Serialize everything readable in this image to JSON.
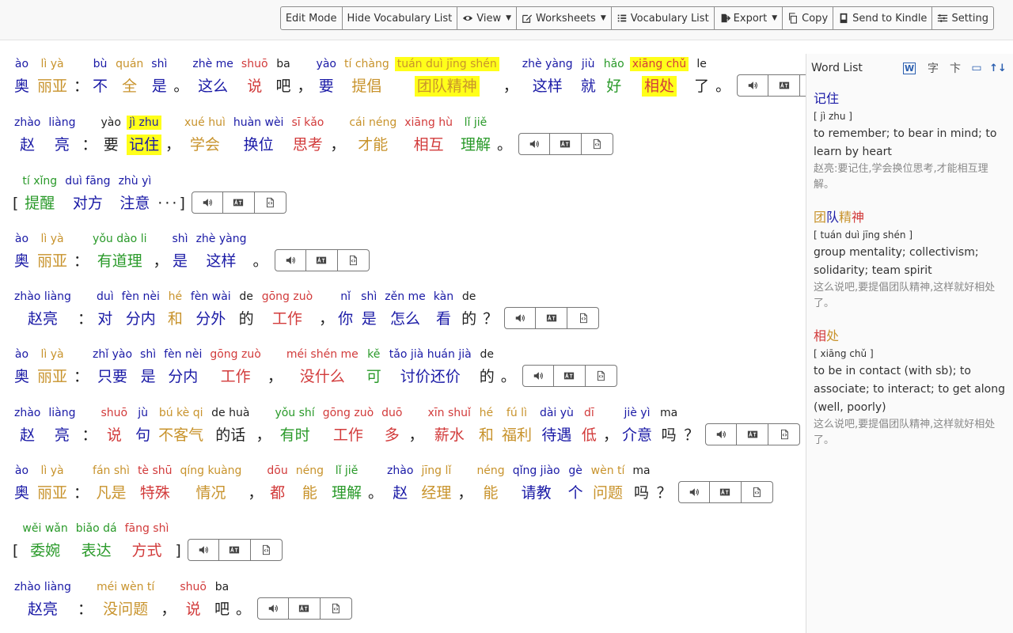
{
  "toolbar": {
    "buttons": [
      {
        "label": "Edit Mode",
        "icon": "",
        "dropdown": false
      },
      {
        "label": "Hide Vocabulary List",
        "icon": "",
        "dropdown": false
      },
      {
        "label": "View",
        "icon": "eye-icon",
        "dropdown": true
      },
      {
        "label": "Worksheets",
        "icon": "edit-icon",
        "dropdown": true
      },
      {
        "label": "Vocabulary List",
        "icon": "list-icon",
        "dropdown": false
      },
      {
        "label": "Export",
        "icon": "export-icon",
        "dropdown": true
      },
      {
        "label": "Copy",
        "icon": "copy-icon",
        "dropdown": false
      },
      {
        "label": "Send to Kindle",
        "icon": "kindle-icon",
        "dropdown": false
      },
      {
        "label": "Setting",
        "icon": "settings-icon",
        "dropdown": false
      }
    ]
  },
  "colors": {
    "blue": "#1a1aa6",
    "orange": "#c8932c",
    "red": "#d23b3b",
    "green": "#2a9a2a",
    "black": "#222222",
    "highlight": "#ffff1a"
  },
  "sentences": [
    {
      "tokens": [
        {
          "p": "ào",
          "h": "奥",
          "c": "b"
        },
        {
          "p": "lì yà",
          "h": "丽亚",
          "c": "o"
        },
        {
          "p": "",
          "h": "：",
          "c": "k"
        },
        {
          "p": "bù",
          "h": "不",
          "c": "b"
        },
        {
          "p": "quán",
          "h": "全",
          "c": "o"
        },
        {
          "p": "shì",
          "h": "是",
          "c": "b"
        },
        {
          "p": "",
          "h": "。",
          "c": "k"
        },
        {
          "p": "zhè me",
          "h": "这么",
          "c": "b"
        },
        {
          "p": "shuō",
          "h": "说",
          "c": "r"
        },
        {
          "p": "ba",
          "h": "吧",
          "c": "k"
        },
        {
          "p": "",
          "h": "，",
          "c": "k"
        },
        {
          "p": "yào",
          "h": "要",
          "c": "b"
        },
        {
          "p": "tí chàng",
          "h": "提倡",
          "c": "o"
        },
        {
          "p": "tuán duì jīng shén",
          "h": "团队精神",
          "c": "o",
          "hl": true
        },
        {
          "p": "",
          "h": "，",
          "c": "k"
        },
        {
          "p": "zhè yàng",
          "h": "这样",
          "c": "b"
        },
        {
          "p": "jiù",
          "h": "就",
          "c": "b"
        },
        {
          "p": "hǎo",
          "h": "好",
          "c": "g"
        },
        {
          "p": "xiāng chǔ",
          "h": "相处",
          "c": "r",
          "hl": true
        },
        {
          "p": "le",
          "h": "了",
          "c": "k"
        },
        {
          "p": "",
          "h": "。",
          "c": "k"
        }
      ]
    },
    {
      "tokens": [
        {
          "p": "zhào",
          "h": "赵",
          "c": "b"
        },
        {
          "p": "liàng",
          "h": "亮",
          "c": "b"
        },
        {
          "p": "",
          "h": "：",
          "c": "k"
        },
        {
          "p": "yào",
          "h": "要",
          "c": "k"
        },
        {
          "p": "jì zhu",
          "h": "记住",
          "c": "b",
          "hl": true
        },
        {
          "p": "",
          "h": "，",
          "c": "k"
        },
        {
          "p": "xué huì",
          "h": "学会",
          "c": "o"
        },
        {
          "p": "huàn wèi",
          "h": "换位",
          "c": "b"
        },
        {
          "p": "sī kǎo",
          "h": "思考",
          "c": "r"
        },
        {
          "p": "",
          "h": "，",
          "c": "k"
        },
        {
          "p": "cái néng",
          "h": "才能",
          "c": "o"
        },
        {
          "p": "xiāng hù",
          "h": "相互",
          "c": "r"
        },
        {
          "p": "lǐ jiě",
          "h": "理解",
          "c": "g"
        },
        {
          "p": "",
          "h": "。",
          "c": "k"
        }
      ]
    },
    {
      "tokens": [
        {
          "p": "",
          "h": "[",
          "c": "k"
        },
        {
          "p": "tí xǐng",
          "h": "提醒",
          "c": "g"
        },
        {
          "p": "duì fāng",
          "h": "对方",
          "c": "b"
        },
        {
          "p": "zhù yì",
          "h": "注意",
          "c": "b"
        },
        {
          "p": "",
          "h": "·",
          "c": "k"
        },
        {
          "p": "",
          "h": "·",
          "c": "k"
        },
        {
          "p": "",
          "h": "·",
          "c": "k"
        },
        {
          "p": "",
          "h": "]",
          "c": "k"
        }
      ]
    },
    {
      "tokens": [
        {
          "p": "ào",
          "h": "奥",
          "c": "b"
        },
        {
          "p": "lì yà",
          "h": "丽亚",
          "c": "o"
        },
        {
          "p": "",
          "h": "：",
          "c": "k"
        },
        {
          "p": "yǒu dào li",
          "h": "有道理",
          "c": "g"
        },
        {
          "p": "",
          "h": "，",
          "c": "k"
        },
        {
          "p": "shì",
          "h": "是",
          "c": "b"
        },
        {
          "p": "zhè yàng",
          "h": "这样",
          "c": "b"
        },
        {
          "p": "",
          "h": "。",
          "c": "k"
        }
      ]
    },
    {
      "tokens": [
        {
          "p": "zhào liàng",
          "h": "赵亮",
          "c": "b"
        },
        {
          "p": "",
          "h": "：",
          "c": "k"
        },
        {
          "p": "duì",
          "h": "对",
          "c": "b"
        },
        {
          "p": "fèn nèi",
          "h": "分内",
          "c": "b"
        },
        {
          "p": "hé",
          "h": "和",
          "c": "o"
        },
        {
          "p": "fèn wài",
          "h": "分外",
          "c": "b"
        },
        {
          "p": "de",
          "h": "的",
          "c": "k"
        },
        {
          "p": "gōng zuò",
          "h": "工作",
          "c": "r"
        },
        {
          "p": "",
          "h": "，",
          "c": "k"
        },
        {
          "p": "nǐ",
          "h": "你",
          "c": "b"
        },
        {
          "p": "shì",
          "h": "是",
          "c": "b"
        },
        {
          "p": "zěn me",
          "h": "怎么",
          "c": "b"
        },
        {
          "p": "kàn",
          "h": "看",
          "c": "b"
        },
        {
          "p": "de",
          "h": "的",
          "c": "k"
        },
        {
          "p": "",
          "h": "？",
          "c": "k"
        }
      ]
    },
    {
      "tokens": [
        {
          "p": "ào",
          "h": "奥",
          "c": "b"
        },
        {
          "p": "lì yà",
          "h": "丽亚",
          "c": "o"
        },
        {
          "p": "",
          "h": "：",
          "c": "k"
        },
        {
          "p": "zhǐ yào",
          "h": "只要",
          "c": "b"
        },
        {
          "p": "shì",
          "h": "是",
          "c": "b"
        },
        {
          "p": "fèn nèi",
          "h": "分内",
          "c": "b"
        },
        {
          "p": "gōng zuò",
          "h": "工作",
          "c": "r"
        },
        {
          "p": "",
          "h": "，",
          "c": "k"
        },
        {
          "p": "méi shén me",
          "h": "没什么",
          "c": "r"
        },
        {
          "p": "kě",
          "h": "可",
          "c": "g"
        },
        {
          "p": "tǎo jià huán jià",
          "h": "讨价还价",
          "c": "b"
        },
        {
          "p": "de",
          "h": "的",
          "c": "k"
        },
        {
          "p": "",
          "h": "。",
          "c": "k"
        }
      ]
    },
    {
      "tokens": [
        {
          "p": "zhào",
          "h": "赵",
          "c": "b"
        },
        {
          "p": "liàng",
          "h": "亮",
          "c": "b"
        },
        {
          "p": "",
          "h": "：",
          "c": "k"
        },
        {
          "p": "shuō",
          "h": "说",
          "c": "r"
        },
        {
          "p": "jù",
          "h": "句",
          "c": "b"
        },
        {
          "p": "bú kè qi",
          "h": "不客气",
          "c": "o"
        },
        {
          "p": "de huà",
          "h": "的话",
          "c": "k"
        },
        {
          "p": "",
          "h": "，",
          "c": "k"
        },
        {
          "p": "yǒu shí",
          "h": "有时",
          "c": "g"
        },
        {
          "p": "gōng zuò",
          "h": "工作",
          "c": "r"
        },
        {
          "p": "duō",
          "h": "多",
          "c": "r"
        },
        {
          "p": "",
          "h": "，",
          "c": "k"
        },
        {
          "p": "xīn shuǐ",
          "h": "薪水",
          "c": "r"
        },
        {
          "p": "hé",
          "h": "和",
          "c": "o"
        },
        {
          "p": "fú lì",
          "h": "福利",
          "c": "o"
        },
        {
          "p": "dài yù",
          "h": "待遇",
          "c": "b"
        },
        {
          "p": "dī",
          "h": "低",
          "c": "r"
        },
        {
          "p": "",
          "h": "，",
          "c": "k"
        },
        {
          "p": "jiè yì",
          "h": "介意",
          "c": "b"
        },
        {
          "p": "ma",
          "h": "吗",
          "c": "k"
        },
        {
          "p": "",
          "h": "？",
          "c": "k"
        }
      ]
    },
    {
      "tokens": [
        {
          "p": "ào",
          "h": "奥",
          "c": "b"
        },
        {
          "p": "lì yà",
          "h": "丽亚",
          "c": "o"
        },
        {
          "p": "",
          "h": "：",
          "c": "k"
        },
        {
          "p": "fán shì",
          "h": "凡是",
          "c": "o"
        },
        {
          "p": "tè shū",
          "h": "特殊",
          "c": "r"
        },
        {
          "p": "qíng kuàng",
          "h": "情况",
          "c": "o"
        },
        {
          "p": "",
          "h": "，",
          "c": "k"
        },
        {
          "p": "dōu",
          "h": "都",
          "c": "r"
        },
        {
          "p": "néng",
          "h": "能",
          "c": "o"
        },
        {
          "p": "lǐ jiě",
          "h": "理解",
          "c": "g"
        },
        {
          "p": "",
          "h": "。",
          "c": "k"
        },
        {
          "p": "zhào",
          "h": "赵",
          "c": "b"
        },
        {
          "p": "jīng lǐ",
          "h": "经理",
          "c": "o"
        },
        {
          "p": "",
          "h": "，",
          "c": "k"
        },
        {
          "p": "néng",
          "h": "能",
          "c": "o"
        },
        {
          "p": "qǐng jiào",
          "h": "请教",
          "c": "b"
        },
        {
          "p": "gè",
          "h": "个",
          "c": "b"
        },
        {
          "p": "wèn tí",
          "h": "问题",
          "c": "o"
        },
        {
          "p": "ma",
          "h": "吗",
          "c": "k"
        },
        {
          "p": "",
          "h": "？",
          "c": "k"
        }
      ]
    },
    {
      "tokens": [
        {
          "p": "",
          "h": "[",
          "c": "k"
        },
        {
          "p": "wěi wǎn",
          "h": "委婉",
          "c": "g"
        },
        {
          "p": "biǎo dá",
          "h": "表达",
          "c": "g"
        },
        {
          "p": "fāng shì",
          "h": "方式",
          "c": "r"
        },
        {
          "p": "",
          "h": "]",
          "c": "k"
        }
      ]
    },
    {
      "tokens": [
        {
          "p": "zhào liàng",
          "h": "赵亮",
          "c": "b"
        },
        {
          "p": "",
          "h": "：",
          "c": "k"
        },
        {
          "p": "méi wèn tí",
          "h": "没问题",
          "c": "o"
        },
        {
          "p": "",
          "h": "，",
          "c": "k"
        },
        {
          "p": "shuō",
          "h": "说",
          "c": "r"
        },
        {
          "p": "ba",
          "h": "吧",
          "c": "k"
        },
        {
          "p": "",
          "h": "。",
          "c": "k"
        }
      ]
    }
  ],
  "sentence_controls": {
    "icons": [
      "audio-icon",
      "translate-icon",
      "copy-sentence-icon"
    ]
  },
  "word_list": {
    "title": "Word List",
    "header_icons": [
      "word-doc-icon",
      "character-icon",
      "stroke-icon",
      "card-icon",
      "sort-icon"
    ],
    "header_glyphs": [
      "W",
      "字",
      "卞",
      "▭",
      "↑↓"
    ],
    "entries": [
      {
        "word_parts": [
          {
            "t": "记",
            "c": "b"
          },
          {
            "t": "住",
            "c": "b"
          }
        ],
        "pinyin": "[ jì zhu ]",
        "definition": "to remember; to bear in mind; to learn by heart",
        "example": "赵亮:要记住,学会换位思考,才能相互理解。"
      },
      {
        "word_parts": [
          {
            "t": "团",
            "c": "o"
          },
          {
            "t": "队",
            "c": "b"
          },
          {
            "t": "精",
            "c": "o"
          },
          {
            "t": "神",
            "c": "r"
          }
        ],
        "pinyin": "[ tuán duì jīng shén ]",
        "definition": "group mentality; collectivism; solidarity; team spirit",
        "example": "这么说吧,要提倡团队精神,这样就好相处了。"
      },
      {
        "word_parts": [
          {
            "t": "相",
            "c": "r"
          },
          {
            "t": "处",
            "c": "o"
          }
        ],
        "pinyin": "[ xiāng chǔ ]",
        "definition": "to be in contact (with sb); to associate; to interact; to get along (well, poorly)",
        "example": "这么说吧,要提倡团队精神,这样就好相处了。"
      }
    ]
  }
}
